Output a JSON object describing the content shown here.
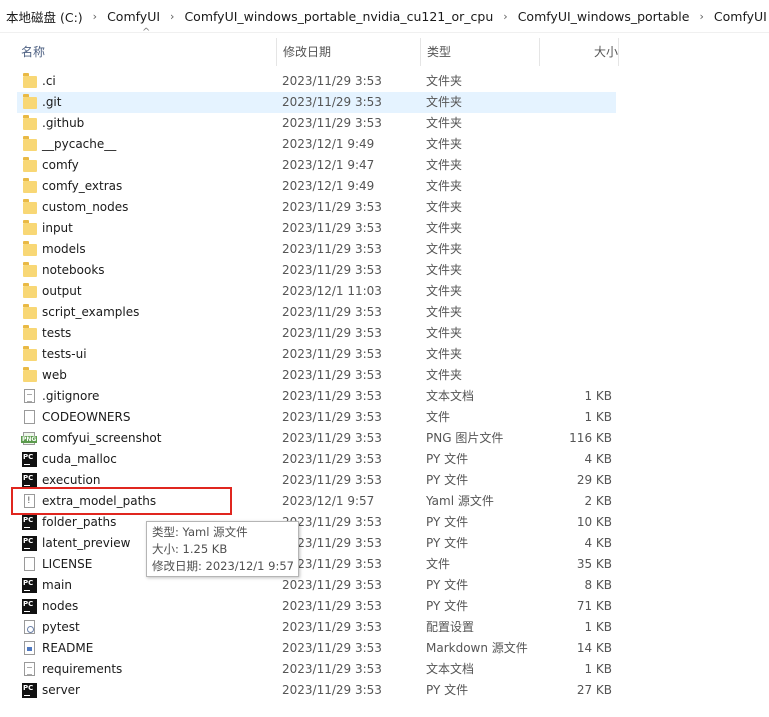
{
  "breadcrumb": [
    "本地磁盘 (C:)",
    "ComfyUI",
    "ComfyUI_windows_portable_nvidia_cu121_or_cpu",
    "ComfyUI_windows_portable",
    "ComfyUI"
  ],
  "breadcrumb_separator": "›",
  "columns": {
    "name": "名称",
    "date": "修改日期",
    "type": "类型",
    "size": "大小"
  },
  "sort_indicator": "^",
  "files": [
    {
      "name": ".ci",
      "date": "2023/11/29 3:53",
      "type": "文件夹",
      "size": "",
      "icon": "folder"
    },
    {
      "name": ".git",
      "date": "2023/11/29 3:53",
      "type": "文件夹",
      "size": "",
      "icon": "folder"
    },
    {
      "name": ".github",
      "date": "2023/11/29 3:53",
      "type": "文件夹",
      "size": "",
      "icon": "folder"
    },
    {
      "name": "__pycache__",
      "date": "2023/12/1 9:49",
      "type": "文件夹",
      "size": "",
      "icon": "folder"
    },
    {
      "name": "comfy",
      "date": "2023/12/1 9:47",
      "type": "文件夹",
      "size": "",
      "icon": "folder"
    },
    {
      "name": "comfy_extras",
      "date": "2023/12/1 9:49",
      "type": "文件夹",
      "size": "",
      "icon": "folder"
    },
    {
      "name": "custom_nodes",
      "date": "2023/11/29 3:53",
      "type": "文件夹",
      "size": "",
      "icon": "folder"
    },
    {
      "name": "input",
      "date": "2023/11/29 3:53",
      "type": "文件夹",
      "size": "",
      "icon": "folder"
    },
    {
      "name": "models",
      "date": "2023/11/29 3:53",
      "type": "文件夹",
      "size": "",
      "icon": "folder"
    },
    {
      "name": "notebooks",
      "date": "2023/11/29 3:53",
      "type": "文件夹",
      "size": "",
      "icon": "folder"
    },
    {
      "name": "output",
      "date": "2023/12/1 11:03",
      "type": "文件夹",
      "size": "",
      "icon": "folder"
    },
    {
      "name": "script_examples",
      "date": "2023/11/29 3:53",
      "type": "文件夹",
      "size": "",
      "icon": "folder"
    },
    {
      "name": "tests",
      "date": "2023/11/29 3:53",
      "type": "文件夹",
      "size": "",
      "icon": "folder"
    },
    {
      "name": "tests-ui",
      "date": "2023/11/29 3:53",
      "type": "文件夹",
      "size": "",
      "icon": "folder"
    },
    {
      "name": "web",
      "date": "2023/11/29 3:53",
      "type": "文件夹",
      "size": "",
      "icon": "folder"
    },
    {
      "name": ".gitignore",
      "date": "2023/11/29 3:53",
      "type": "文本文档",
      "size": "1 KB",
      "icon": "text"
    },
    {
      "name": "CODEOWNERS",
      "date": "2023/11/29 3:53",
      "type": "文件",
      "size": "1 KB",
      "icon": "file"
    },
    {
      "name": "comfyui_screenshot",
      "date": "2023/11/29 3:53",
      "type": "PNG 图片文件",
      "size": "116 KB",
      "icon": "png"
    },
    {
      "name": "cuda_malloc",
      "date": "2023/11/29 3:53",
      "type": "PY 文件",
      "size": "4 KB",
      "icon": "py"
    },
    {
      "name": "execution",
      "date": "2023/11/29 3:53",
      "type": "PY 文件",
      "size": "29 KB",
      "icon": "py"
    },
    {
      "name": "extra_model_paths",
      "date": "2023/12/1 9:57",
      "type": "Yaml 源文件",
      "size": "2 KB",
      "icon": "yaml"
    },
    {
      "name": "folder_paths",
      "date": "2023/11/29 3:53",
      "type": "PY 文件",
      "size": "10 KB",
      "icon": "py"
    },
    {
      "name": "latent_preview",
      "date": "2023/11/29 3:53",
      "type": "PY 文件",
      "size": "4 KB",
      "icon": "py"
    },
    {
      "name": "LICENSE",
      "date": "2023/11/29 3:53",
      "type": "文件",
      "size": "35 KB",
      "icon": "file"
    },
    {
      "name": "main",
      "date": "2023/11/29 3:53",
      "type": "PY 文件",
      "size": "8 KB",
      "icon": "py"
    },
    {
      "name": "nodes",
      "date": "2023/11/29 3:53",
      "type": "PY 文件",
      "size": "71 KB",
      "icon": "py"
    },
    {
      "name": "pytest",
      "date": "2023/11/29 3:53",
      "type": "配置设置",
      "size": "1 KB",
      "icon": "config"
    },
    {
      "name": "README",
      "date": "2023/11/29 3:53",
      "type": "Markdown 源文件",
      "size": "14 KB",
      "icon": "markdown"
    },
    {
      "name": "requirements",
      "date": "2023/11/29 3:53",
      "type": "文本文档",
      "size": "1 KB",
      "icon": "text"
    },
    {
      "name": "server",
      "date": "2023/11/29 3:53",
      "type": "PY 文件",
      "size": "27 KB",
      "icon": "py"
    }
  ],
  "selected_row": ".git",
  "highlighted_file": "extra_model_paths",
  "tooltip": {
    "type_line": "类型: Yaml 源文件",
    "size_line": "大小: 1.25 KB",
    "date_line": "修改日期: 2023/12/1 9:57"
  },
  "colors": {
    "selection": "#e5f3ff",
    "highlight_box": "#e0261f",
    "folder": "#f8d775",
    "header_text": "#4d6082"
  }
}
